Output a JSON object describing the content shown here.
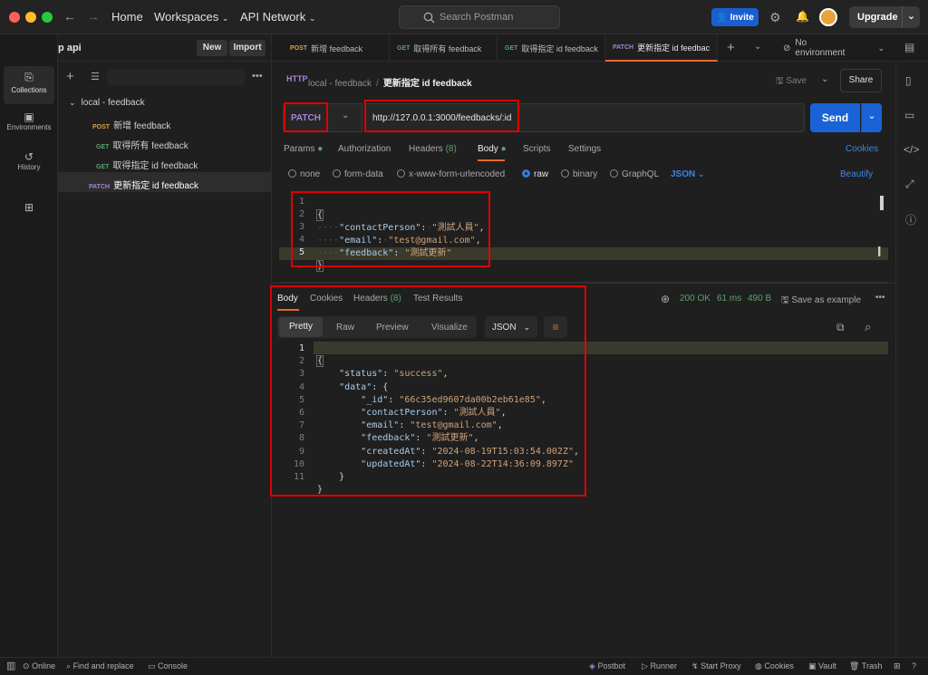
{
  "window": {
    "nav": {
      "home": "Home",
      "workspaces": "Workspaces",
      "api_network": "API Network"
    },
    "search_placeholder": "Search Postman",
    "invite": "Invite",
    "upgrade": "Upgrade"
  },
  "workspace": {
    "name": "test-app api",
    "new": "New",
    "import": "Import"
  },
  "rail": [
    {
      "label": "Collections",
      "icon": "collections-icon"
    },
    {
      "label": "Environments",
      "icon": "environments-icon"
    },
    {
      "label": "History",
      "icon": "history-icon"
    }
  ],
  "sidebar": {
    "collection": "local - feedback",
    "items": [
      {
        "method": "POST",
        "name": "新增 feedback"
      },
      {
        "method": "GET",
        "name": "取得所有 feedback"
      },
      {
        "method": "GET",
        "name": "取得指定 id feedback"
      },
      {
        "method": "PATCH",
        "name": "更新指定 id feedback"
      }
    ]
  },
  "tabs": [
    {
      "method": "POST",
      "name": "新增 feedback"
    },
    {
      "method": "GET",
      "name": "取得所有 feedback"
    },
    {
      "method": "GET",
      "name": "取得指定 id feedback"
    },
    {
      "method": "PATCH",
      "name": "更新指定 id feedbac"
    }
  ],
  "environment": "No environment",
  "breadcrumb": {
    "collection": "local - feedback",
    "request": "更新指定 id feedback"
  },
  "save": "Save",
  "share": "Share",
  "request": {
    "method": "PATCH",
    "url": "http://127.0.0.1:3000/feedbacks/:id",
    "send": "Send",
    "tabs": {
      "params": "Params",
      "authorization": "Authorization",
      "headers": "Headers",
      "headers_count": "(8)",
      "body": "Body",
      "scripts": "Scripts",
      "settings": "Settings",
      "cookies": "Cookies"
    },
    "body_types": {
      "none": "none",
      "form_data": "form-data",
      "urlencoded": "x-www-form-urlencoded",
      "raw": "raw",
      "binary": "binary",
      "graphql": "GraphQL",
      "format": "JSON",
      "beautify": "Beautify"
    },
    "body_line_numbers": [
      "1",
      "2",
      "3",
      "4",
      "5"
    ],
    "body": {
      "open": "{",
      "k1": "\"contactPerson\"",
      "v1": "\"測試人員\"",
      "k2": "\"email\"",
      "v2": "\"test@gmail.com\"",
      "k3": "\"feedback\"",
      "v3": "\"測試更新\"",
      "close": "}"
    }
  },
  "response": {
    "tabs": {
      "body": "Body",
      "cookies": "Cookies",
      "headers": "Headers",
      "headers_count": "(8)",
      "tests": "Test Results"
    },
    "status": "200 OK",
    "time": "61 ms",
    "size": "490 B",
    "save_example": "Save as example",
    "views": {
      "pretty": "Pretty",
      "raw": "Raw",
      "preview": "Preview",
      "visualize": "Visualize",
      "format": "JSON"
    },
    "line_numbers": [
      "1",
      "2",
      "3",
      "4",
      "5",
      "6",
      "7",
      "8",
      "9",
      "10",
      "11"
    ],
    "body": {
      "open": "{",
      "k_status": "\"status\"",
      "v_status": "\"success\"",
      "k_data": "\"data\"",
      "data_open": "{",
      "k_id": "\"_id\"",
      "v_id": "\"66c35ed9607da00b2eb61e85\"",
      "k_contact": "\"contactPerson\"",
      "v_contact": "\"測試人員\"",
      "k_email": "\"email\"",
      "v_email": "\"test@gmail.com\"",
      "k_feedback": "\"feedback\"",
      "v_feedback": "\"測試更新\"",
      "k_created": "\"createdAt\"",
      "v_created": "\"2024-08-19T15:03:54.002Z\"",
      "k_updated": "\"updatedAt\"",
      "v_updated": "\"2024-08-22T14:36:09.897Z\"",
      "data_close": "}",
      "close": "}"
    }
  },
  "statusbar": {
    "online": "Online",
    "find": "Find and replace",
    "console": "Console",
    "postbot": "Postbot",
    "runner": "Runner",
    "proxy": "Start Proxy",
    "cookies": "Cookies",
    "vault": "Vault",
    "trash": "Trash"
  },
  "colors": {
    "accent": "#1a63d6",
    "highlight": "#e00000",
    "patch": "#a684d6",
    "get": "#5aa36b",
    "post": "#d9a33c",
    "status_ok": "#5aa36b"
  }
}
